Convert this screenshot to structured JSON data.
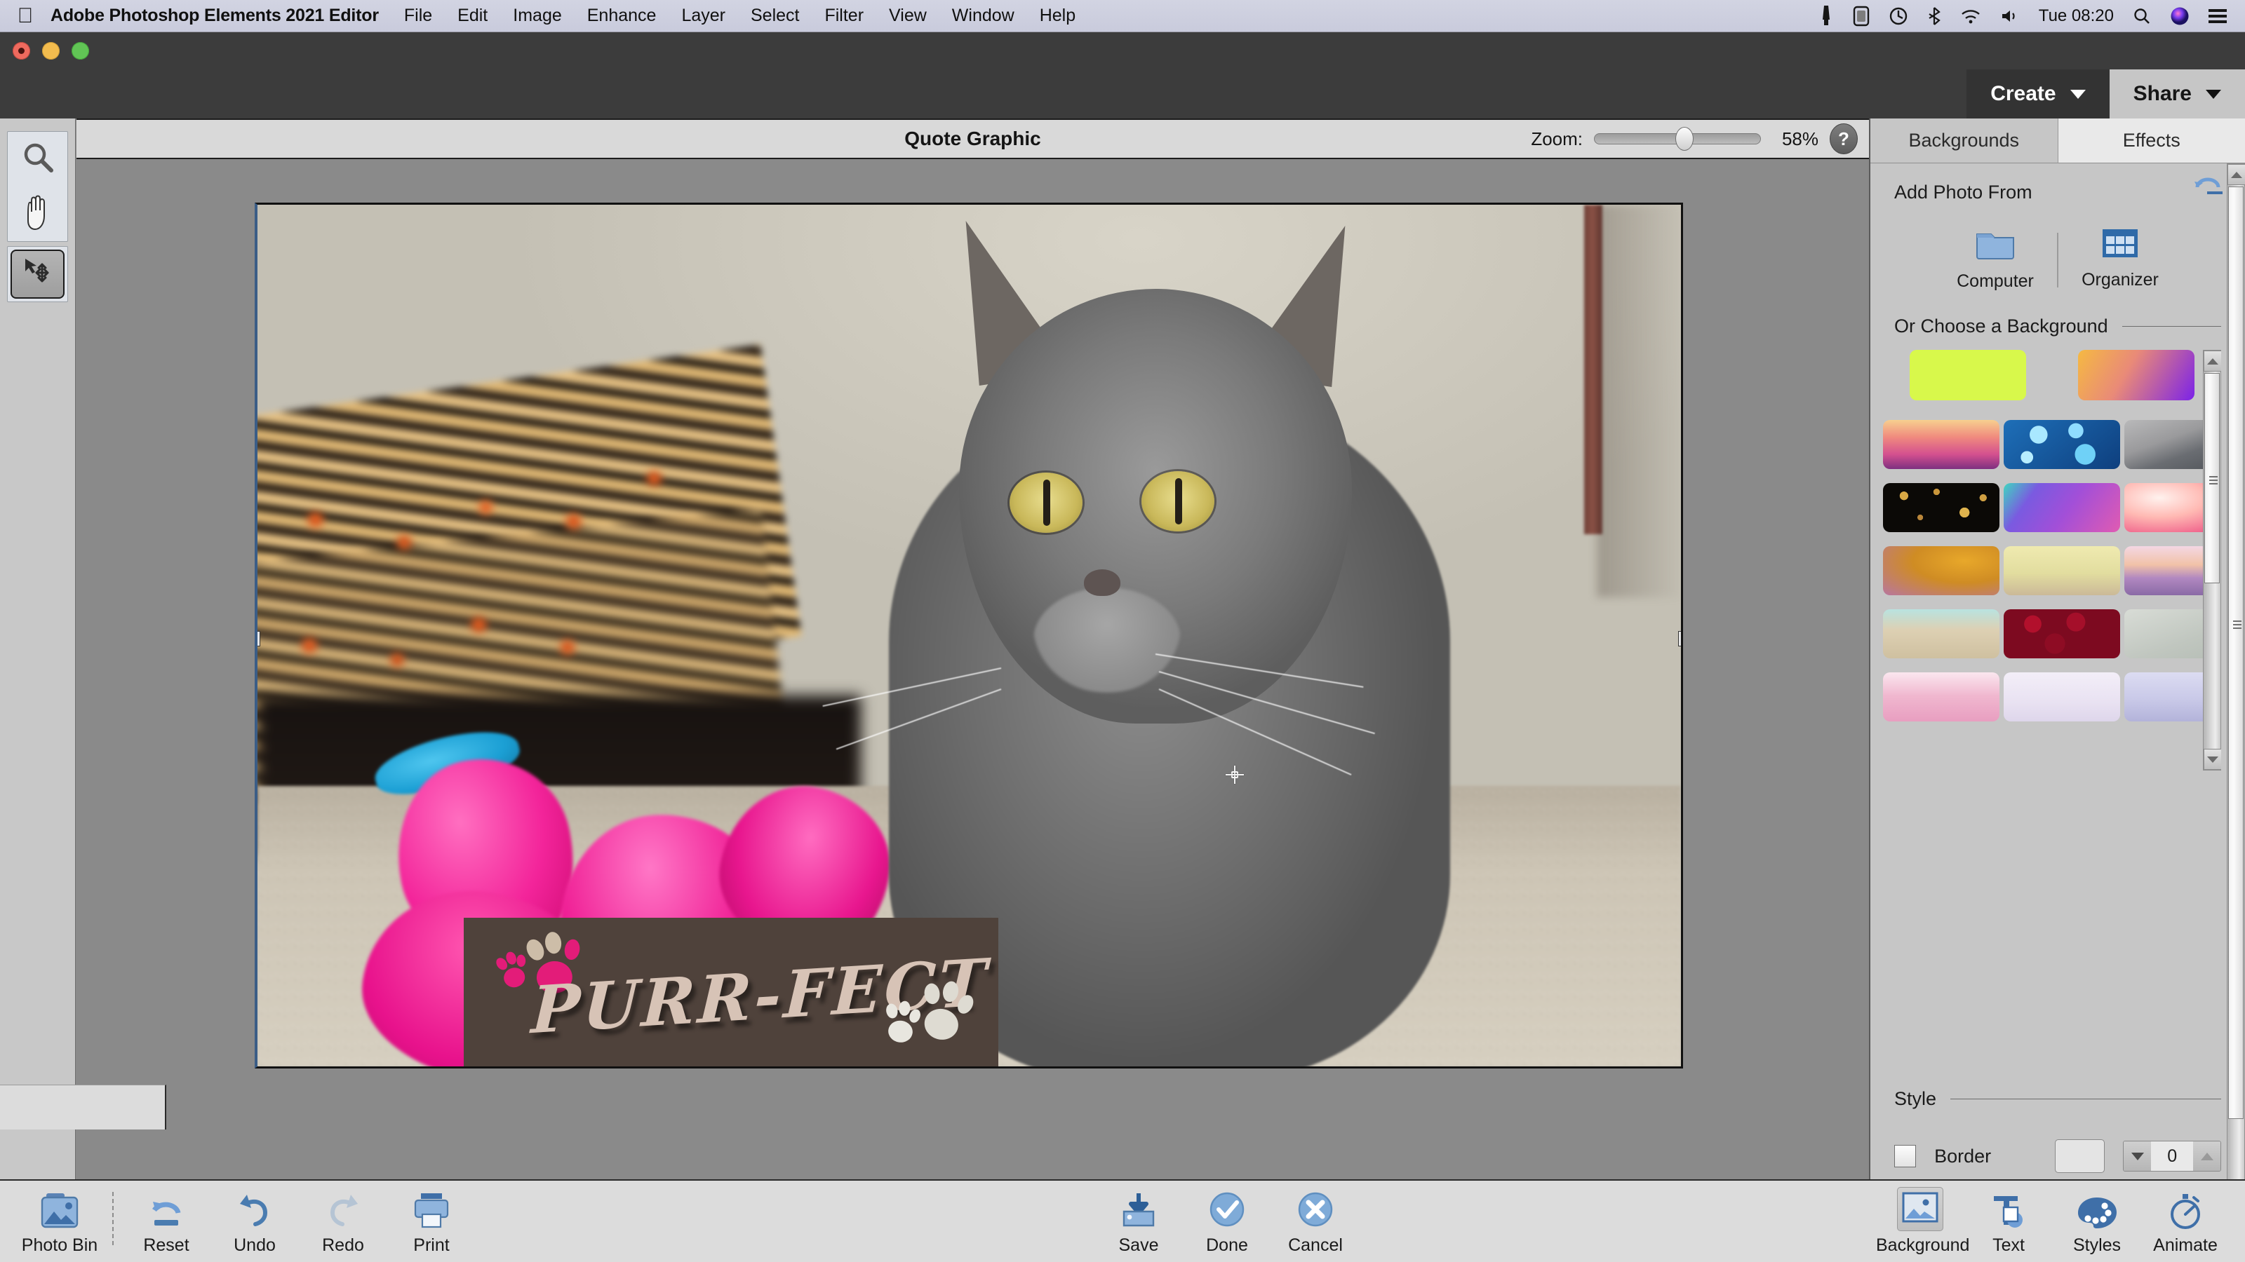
{
  "menubar": {
    "apple_icon": "apple-logo-icon",
    "app_name": "Adobe Photoshop Elements 2021 Editor",
    "menus": [
      "File",
      "Edit",
      "Image",
      "Enhance",
      "Layer",
      "Select",
      "Filter",
      "View",
      "Window",
      "Help"
    ],
    "status_icons": [
      "display-icon",
      "battery-icon",
      "time-machine-icon",
      "bluetooth-icon",
      "wifi-icon",
      "volume-icon"
    ],
    "clock": "Tue 08:20",
    "right_icons": [
      "search-icon",
      "siri-icon",
      "control-center-icon"
    ]
  },
  "window": {
    "traffic_lights": [
      "close-button",
      "minimize-button",
      "zoom-button"
    ]
  },
  "topbar": {
    "create_label": "Create",
    "share_label": "Share"
  },
  "tools": [
    {
      "name": "zoom-tool",
      "icon": "magnifier-icon"
    },
    {
      "name": "hand-tool",
      "icon": "hand-icon"
    },
    {
      "name": "move-tool",
      "icon": "move-arrows-icon",
      "active": true
    }
  ],
  "document": {
    "title": "Quote Graphic",
    "zoom_label": "Zoom:",
    "zoom_percent": "58%",
    "zoom_slider_value": 58,
    "help_label": "?"
  },
  "artwork": {
    "banner_text": "PURR-FECT",
    "banner_bg_color": "#4f423b",
    "banner_text_color": "#d7c3b6",
    "paw_pink_color": "#e31c79",
    "paw_tan_color": "#cdbda8",
    "paw_white_color": "#e8e6df",
    "subject": "gray cat photo"
  },
  "right_panel": {
    "tabs": [
      {
        "label": "Backgrounds",
        "active": true
      },
      {
        "label": "Effects",
        "active": false
      }
    ],
    "add_photo": {
      "title": "Add Photo From",
      "reset_icon": "reset-arrow-icon",
      "sources": [
        {
          "label": "Computer",
          "icon": "folder-icon"
        },
        {
          "label": "Organizer",
          "icon": "grid-icon"
        }
      ]
    },
    "choose_background": {
      "title": "Or Choose a Background",
      "featured": [
        {
          "name": "lime-solid",
          "css": "#d8f84b"
        },
        {
          "name": "orange-purple-gradient",
          "css": "linear-gradient(120deg,#f5b942 0%,#e98a78 42%,#7b22e8 100%)"
        }
      ],
      "thumbnails": [
        {
          "name": "pink-mountains",
          "css": "linear-gradient(180deg,#f7cf8f 0%,#f08a7e 35%,#d4508f 70%,#7e3080 100%)"
        },
        {
          "name": "blue-bokeh",
          "css": "radial-gradient(circle 26px at 30% 30%,#a9e8ff 0 48%,transparent 50%), radial-gradient(circle 22px at 62% 22%,#8fdcff 0 48%,transparent 50%), radial-gradient(circle 30px at 70% 70%,#6fd1f7 0 48%,transparent 50%), radial-gradient(circle 18px at 20% 76%,#b7edff 0 48%,transparent 50%), linear-gradient(140deg,#1e6fb8,#0e3f7e)"
        },
        {
          "name": "foggy-forest",
          "css": "linear-gradient(160deg,#b9b9ba 0%,#9a9a9c 38%,#6a6d72 62%,#4c5055 100%)"
        },
        {
          "name": "dark-bokeh-lights",
          "css": "radial-gradient(circle 12px at 18% 26%,#d8a845 0 50%,transparent 52%), radial-gradient(circle 9px at 46% 18%,#c9963b 0 50%,transparent 52%), radial-gradient(circle 14px at 70% 60%,#e0b44e 0 50%,transparent 52%), radial-gradient(circle 8px at 32% 70%,#b9863a 0 50%,transparent 52%), radial-gradient(circle 10px at 86% 30%,#cf9f42 0 50%,transparent 52%), #0b0906"
        },
        {
          "name": "purple-polygons",
          "css": "linear-gradient(125deg,#3fd6c0 0%,#7a5ae0 24%,#a24fd8 55%,#e05bb2 100%)"
        },
        {
          "name": "pink-watercolor",
          "css": "radial-gradient(ellipse at 30% 30%,#fff2ee 0%,#ffb9b3 40%,#f0648c 80%,#e14a7a 100%)"
        },
        {
          "name": "gold-forget-me-nots",
          "css": "radial-gradient(ellipse at 70% 30%,#e8a82a 0%,#cf8c24 45%,#b8769f 100%)"
        },
        {
          "name": "cosmos-flowers",
          "css": "linear-gradient(180deg,#efeab0 0%,#e2dd9f 55%,#cbb998 100%)"
        },
        {
          "name": "lavender-field-sunset",
          "css": "linear-gradient(180deg,#f4d7e3 0%,#f1c2a8 38%,#b188c0 65%,#8a6aa6 100%)"
        },
        {
          "name": "starfish-beach",
          "css": "linear-gradient(180deg,#b9e3e0 0%,#ddd0b3 42%,#cfc0a0 100%)"
        },
        {
          "name": "red-roses",
          "css": "radial-gradient(circle 22px at 25% 30%,#b2102c 0 55%,transparent 57%), radial-gradient(circle 24px at 62% 26%,#a50f2a 0 55%,transparent 57%), radial-gradient(circle 26px at 44% 70%,#8e0c24 0 55%,transparent 57%), #7d0a20"
        },
        {
          "name": "water-droplets",
          "css": "linear-gradient(160deg,#d8dcd6,#c0c6bf 60%,#b4bcb4)"
        },
        {
          "name": "pink-glitter",
          "css": "linear-gradient(180deg,#fbe7ef 0%,#f0b7cf 48%,#e89ec0 100%)"
        },
        {
          "name": "handwriting-paper",
          "css": "linear-gradient(180deg,#f3eef8,#e9e2f2 60%,#ded6eb)"
        },
        {
          "name": "winter-trees",
          "css": "linear-gradient(180deg,#dcdcf2 0%,#c9c9e8 55%,#b3b3da 100%)"
        }
      ]
    },
    "style": {
      "title": "Style",
      "border_label": "Border",
      "border_checked": false,
      "border_color": "#e4e4e4",
      "border_width": "0"
    }
  },
  "bottombar": {
    "left_items": [
      {
        "label": "Photo Bin",
        "icon": "photo-bin-icon"
      },
      {
        "label": "Reset",
        "icon": "reset-icon"
      },
      {
        "label": "Undo",
        "icon": "undo-icon"
      },
      {
        "label": "Redo",
        "icon": "redo-icon"
      },
      {
        "label": "Print",
        "icon": "print-icon"
      }
    ],
    "center_items": [
      {
        "label": "Save",
        "icon": "save-icon"
      },
      {
        "label": "Done",
        "icon": "check-circle-icon"
      },
      {
        "label": "Cancel",
        "icon": "x-circle-icon"
      }
    ],
    "right_items": [
      {
        "label": "Background",
        "icon": "background-image-icon",
        "selected": true
      },
      {
        "label": "Text",
        "icon": "text-tool-icon",
        "selected": false
      },
      {
        "label": "Styles",
        "icon": "palette-icon",
        "selected": false
      },
      {
        "label": "Animate",
        "icon": "stopwatch-icon",
        "selected": false
      }
    ]
  }
}
